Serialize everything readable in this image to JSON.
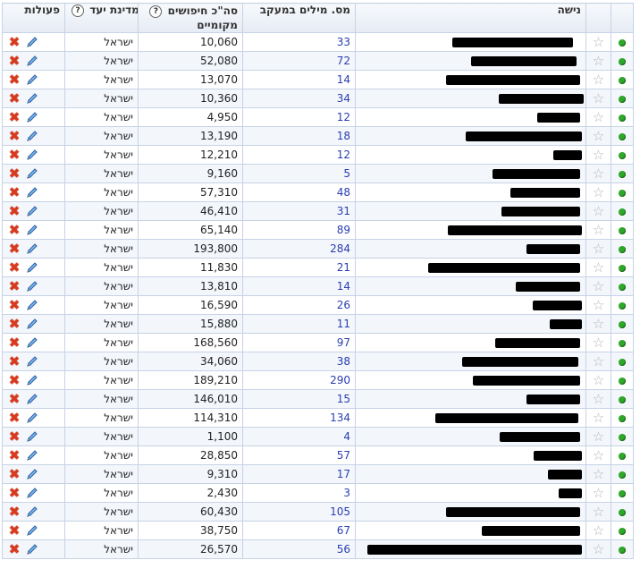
{
  "headers": {
    "actions": "פעולות",
    "country": "מדינת יעד",
    "searches": "סה\"כ חיפושים מקומיים",
    "words": "מס. מילים במעקב",
    "niche": "נישה",
    "help_glyph": "?"
  },
  "icons": {
    "delete": "delete-icon",
    "edit": "pencil-icon",
    "star": "star-icon",
    "status": "status-dot-icon"
  },
  "colors": {
    "status_active": "#2fa82a",
    "delete": "#d93a1e",
    "link": "#2a3eb1"
  },
  "rows": [
    {
      "country": "ישראל",
      "searches": "10,060",
      "words": "33",
      "redacted": true
    },
    {
      "country": "ישראל",
      "searches": "52,080",
      "words": "72",
      "redacted": true
    },
    {
      "country": "ישראל",
      "searches": "13,070",
      "words": "14",
      "redacted": true
    },
    {
      "country": "ישראל",
      "searches": "10,360",
      "words": "34",
      "redacted": true
    },
    {
      "country": "ישראל",
      "searches": "4,950",
      "words": "12",
      "redacted": true
    },
    {
      "country": "ישראל",
      "searches": "13,190",
      "words": "18",
      "redacted": true
    },
    {
      "country": "ישראל",
      "searches": "12,210",
      "words": "12",
      "redacted": true
    },
    {
      "country": "ישראל",
      "searches": "9,160",
      "words": "5",
      "redacted": true
    },
    {
      "country": "ישראל",
      "searches": "57,310",
      "words": "48",
      "redacted": true
    },
    {
      "country": "ישראל",
      "searches": "46,410",
      "words": "31",
      "redacted": true
    },
    {
      "country": "ישראל",
      "searches": "65,140",
      "words": "89",
      "redacted": true
    },
    {
      "country": "ישראל",
      "searches": "193,800",
      "words": "284",
      "redacted": true
    },
    {
      "country": "ישראל",
      "searches": "11,830",
      "words": "21",
      "redacted": true
    },
    {
      "country": "ישראל",
      "searches": "13,810",
      "words": "14",
      "redacted": true
    },
    {
      "country": "ישראל",
      "searches": "16,590",
      "words": "26",
      "redacted": true
    },
    {
      "country": "ישראל",
      "searches": "15,880",
      "words": "11",
      "redacted": true
    },
    {
      "country": "ישראל",
      "searches": "168,560",
      "words": "97",
      "redacted": true
    },
    {
      "country": "ישראל",
      "searches": "34,060",
      "words": "38",
      "redacted": true
    },
    {
      "country": "ישראל",
      "searches": "189,210",
      "words": "290",
      "redacted": true
    },
    {
      "country": "ישראל",
      "searches": "146,010",
      "words": "15",
      "redacted": true
    },
    {
      "country": "ישראל",
      "searches": "114,310",
      "words": "134",
      "redacted": true
    },
    {
      "country": "ישראל",
      "searches": "1,100",
      "words": "4",
      "redacted": true
    },
    {
      "country": "ישראל",
      "searches": "28,850",
      "words": "57",
      "redacted": true
    },
    {
      "country": "ישראל",
      "searches": "9,310",
      "words": "17",
      "redacted": true
    },
    {
      "country": "ישראל",
      "searches": "2,430",
      "words": "3",
      "redacted": true
    },
    {
      "country": "ישראל",
      "searches": "60,430",
      "words": "105",
      "redacted": true
    },
    {
      "country": "ישראל",
      "searches": "38,750",
      "words": "67",
      "redacted": true
    },
    {
      "country": "ישראל",
      "searches": "26,570",
      "words": "56",
      "redacted": true
    }
  ]
}
